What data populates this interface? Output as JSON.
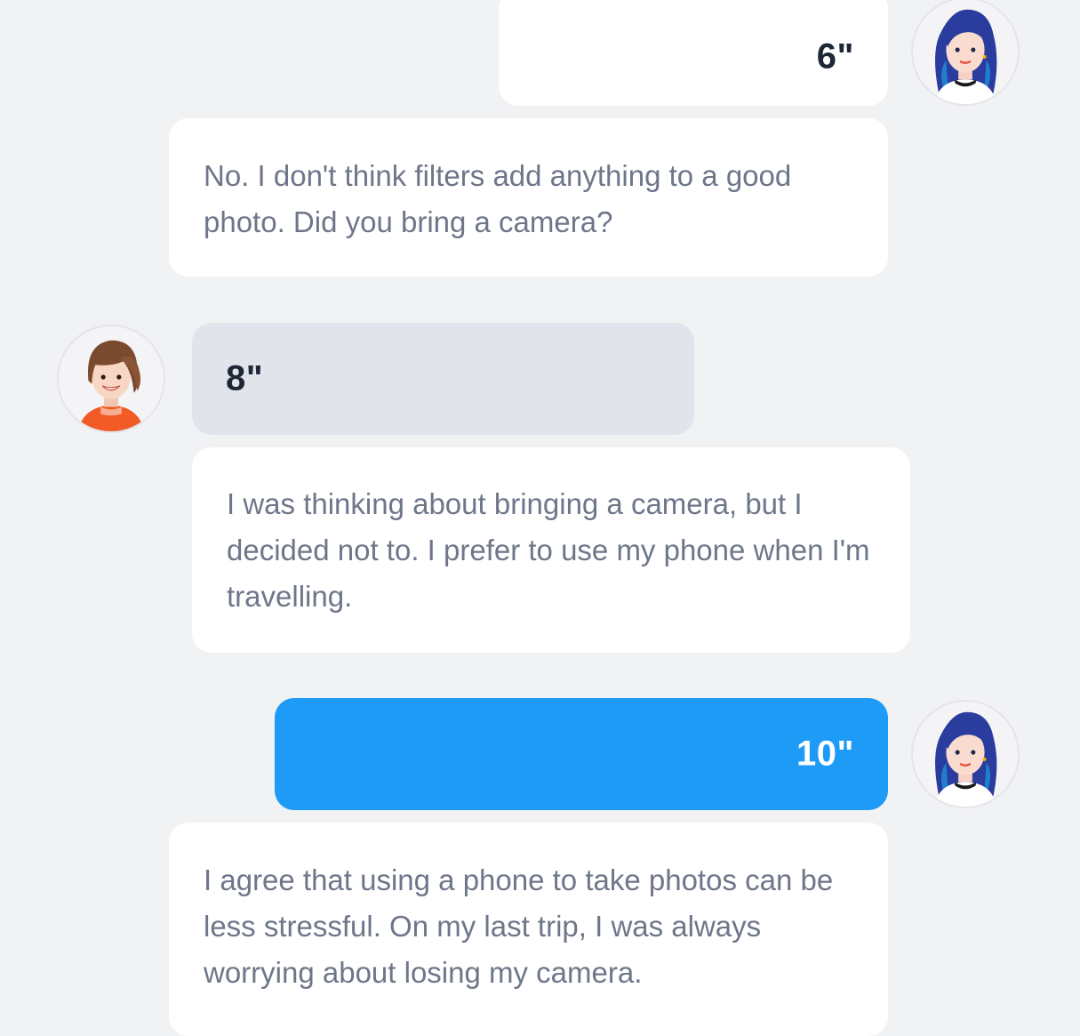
{
  "chat": {
    "messages": [
      {
        "speaker": "right",
        "kind": "audio",
        "duration": "6\"",
        "style": "white"
      },
      {
        "speaker": "right",
        "kind": "text",
        "text": "No. I don't think filters add anything to a good photo. Did you bring a camera?"
      },
      {
        "speaker": "left",
        "kind": "audio",
        "duration": "8\"",
        "style": "grey"
      },
      {
        "speaker": "left",
        "kind": "text",
        "text": "I was thinking about bringing a camera, but I decided not to. I prefer to use my phone when I'm travelling."
      },
      {
        "speaker": "right",
        "kind": "audio",
        "duration": "10\"",
        "style": "blue"
      },
      {
        "speaker": "right",
        "kind": "text",
        "text": "I agree that using a phone to take photos can be less stressful. On my last trip, I was always worrying about losing my camera."
      }
    ]
  },
  "icons": {
    "right_avatar": "woman-blue-hair-avatar",
    "left_avatar": "woman-brown-hair-avatar"
  },
  "colors": {
    "background": "#f1f2f4",
    "bubble_white": "#ffffff",
    "bubble_grey": "#e1e5eb",
    "bubble_blue": "#1d9bf7",
    "message_text": "#6e7689",
    "duration_text": "#1e2736"
  }
}
